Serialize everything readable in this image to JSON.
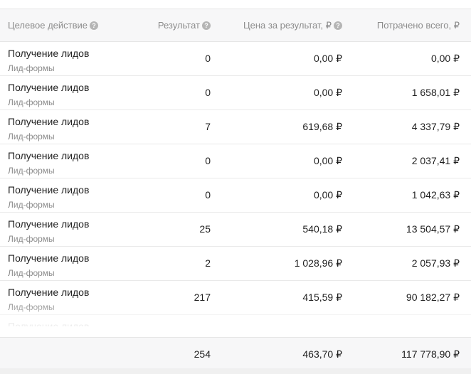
{
  "header": {
    "action": "Целевое действие",
    "result": "Результат",
    "price": "Цена за результат, ₽",
    "spent": "Потрачено всего, ₽"
  },
  "rows": [
    {
      "title": "Получение лидов",
      "sub": "Лид-формы",
      "result": "0",
      "price": "0,00 ₽",
      "spent": "0,00 ₽"
    },
    {
      "title": "Получение лидов",
      "sub": "Лид-формы",
      "result": "0",
      "price": "0,00 ₽",
      "spent": "1 658,01 ₽"
    },
    {
      "title": "Получение лидов",
      "sub": "Лид-формы",
      "result": "7",
      "price": "619,68 ₽",
      "spent": "4 337,79 ₽"
    },
    {
      "title": "Получение лидов",
      "sub": "Лид-формы",
      "result": "0",
      "price": "0,00 ₽",
      "spent": "2 037,41 ₽"
    },
    {
      "title": "Получение лидов",
      "sub": "Лид-формы",
      "result": "0",
      "price": "0,00 ₽",
      "spent": "1 042,63 ₽"
    },
    {
      "title": "Получение лидов",
      "sub": "Лид-формы",
      "result": "25",
      "price": "540,18 ₽",
      "spent": "13 504,57 ₽"
    },
    {
      "title": "Получение лидов",
      "sub": "Лид-формы",
      "result": "2",
      "price": "1 028,96 ₽",
      "spent": "2 057,93 ₽"
    },
    {
      "title": "Получение лидов",
      "sub": "Лид-формы",
      "result": "217",
      "price": "415,59 ₽",
      "spent": "90 182,27 ₽"
    },
    {
      "title": "Получение лидов",
      "sub": "",
      "result": "",
      "price": "",
      "spent": ""
    }
  ],
  "total": {
    "result": "254",
    "price": "463,70 ₽",
    "spent": "117 778,90 ₽"
  },
  "icons": {
    "help": "question-circle-icon"
  }
}
